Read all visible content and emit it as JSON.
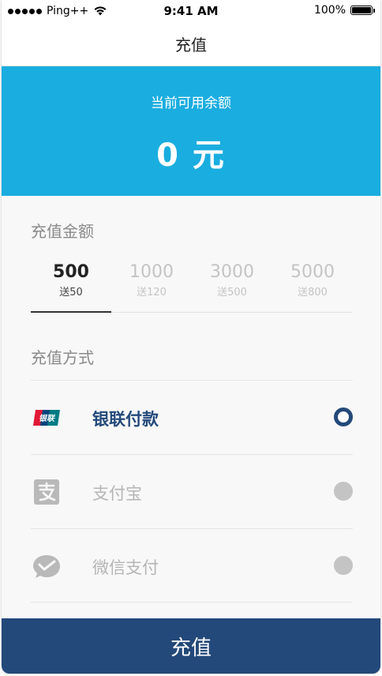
{
  "status_bar": {
    "carrier": "Ping++",
    "time": "9:41 AM",
    "battery": "100%"
  },
  "nav": {
    "title": "充值"
  },
  "balance": {
    "label": "当前可用余额",
    "value": "0 元"
  },
  "amount_section": {
    "title": "充值金额",
    "options": [
      {
        "value": "500",
        "bonus": "送50",
        "selected": true
      },
      {
        "value": "1000",
        "bonus": "送120",
        "selected": false
      },
      {
        "value": "3000",
        "bonus": "送500",
        "selected": false
      },
      {
        "value": "5000",
        "bonus": "送800",
        "selected": false
      }
    ]
  },
  "payment_section": {
    "title": "充值方式",
    "methods": [
      {
        "label": "银联付款",
        "icon": "unionpay-icon",
        "selected": true
      },
      {
        "label": "支付宝",
        "icon": "alipay-icon",
        "selected": false
      },
      {
        "label": "微信支付",
        "icon": "wechat-pay-icon",
        "selected": false
      }
    ]
  },
  "submit": {
    "label": "充值"
  },
  "colors": {
    "banner": "#1aade0",
    "primary": "#23497a",
    "muted": "#c4c4c4"
  },
  "icon_text": {
    "unionpay": "银联"
  }
}
